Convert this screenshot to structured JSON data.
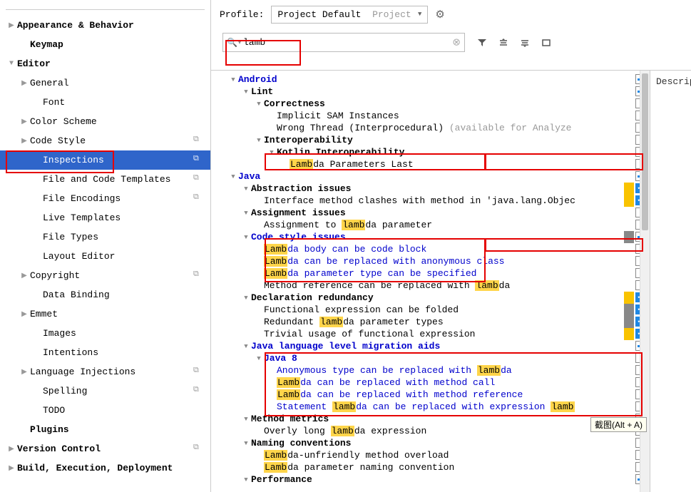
{
  "sidebar": {
    "items": [
      {
        "label": "Appearance & Behavior",
        "arrow": "right",
        "bold": true,
        "ind": 0
      },
      {
        "label": "Keymap",
        "arrow": "",
        "bold": true,
        "ind": 1
      },
      {
        "label": "Editor",
        "arrow": "down",
        "bold": true,
        "ind": 0
      },
      {
        "label": "General",
        "arrow": "right",
        "bold": false,
        "ind": 1
      },
      {
        "label": "Font",
        "arrow": "",
        "bold": false,
        "ind": 2
      },
      {
        "label": "Color Scheme",
        "arrow": "right",
        "bold": false,
        "ind": 1
      },
      {
        "label": "Code Style",
        "arrow": "right",
        "bold": false,
        "ind": 1,
        "copy": true
      },
      {
        "label": "Inspections",
        "arrow": "",
        "bold": false,
        "ind": 2,
        "copy": true,
        "selected": true
      },
      {
        "label": "File and Code Templates",
        "arrow": "",
        "bold": false,
        "ind": 2,
        "copy": true
      },
      {
        "label": "File Encodings",
        "arrow": "",
        "bold": false,
        "ind": 2,
        "copy": true
      },
      {
        "label": "Live Templates",
        "arrow": "",
        "bold": false,
        "ind": 2
      },
      {
        "label": "File Types",
        "arrow": "",
        "bold": false,
        "ind": 2
      },
      {
        "label": "Layout Editor",
        "arrow": "",
        "bold": false,
        "ind": 2
      },
      {
        "label": "Copyright",
        "arrow": "right",
        "bold": false,
        "ind": 1,
        "copy": true
      },
      {
        "label": "Data Binding",
        "arrow": "",
        "bold": false,
        "ind": 2
      },
      {
        "label": "Emmet",
        "arrow": "right",
        "bold": false,
        "ind": 1
      },
      {
        "label": "Images",
        "arrow": "",
        "bold": false,
        "ind": 2
      },
      {
        "label": "Intentions",
        "arrow": "",
        "bold": false,
        "ind": 2
      },
      {
        "label": "Language Injections",
        "arrow": "right",
        "bold": false,
        "ind": 1,
        "copy": true
      },
      {
        "label": "Spelling",
        "arrow": "",
        "bold": false,
        "ind": 2,
        "copy": true
      },
      {
        "label": "TODO",
        "arrow": "",
        "bold": false,
        "ind": 2
      },
      {
        "label": "Plugins",
        "arrow": "",
        "bold": true,
        "ind": 1
      },
      {
        "label": "Version Control",
        "arrow": "right",
        "bold": true,
        "ind": 0,
        "copy": true
      },
      {
        "label": "Build, Execution, Deployment",
        "arrow": "right",
        "bold": true,
        "ind": 0
      }
    ]
  },
  "profile": {
    "label": "Profile:",
    "name": "Project Default",
    "scope": "Project"
  },
  "search": {
    "value": "lamb",
    "placeholder": ""
  },
  "right_panel": {
    "label": "Descripti"
  },
  "tooltip": "截图(Alt + A)",
  "tree": [
    {
      "ind": 0,
      "arrow": "down",
      "parts": [
        {
          "t": "Android",
          "cls": "blue-link bold"
        }
      ],
      "chk": "mixed"
    },
    {
      "ind": 1,
      "arrow": "down",
      "parts": [
        {
          "t": "Lint",
          "cls": "bold"
        }
      ],
      "chk": "mixed"
    },
    {
      "ind": 2,
      "arrow": "down",
      "parts": [
        {
          "t": "Correctness",
          "cls": "bold"
        }
      ],
      "chk": ""
    },
    {
      "ind": 3,
      "arrow": "",
      "parts": [
        {
          "t": "Implicit SAM Instances"
        }
      ],
      "chk": ""
    },
    {
      "ind": 3,
      "arrow": "",
      "parts": [
        {
          "t": "Wrong Thread (Interprocedural) "
        },
        {
          "t": "(available for Analyze",
          "cls": "gray-txt"
        }
      ],
      "chk": ""
    },
    {
      "ind": 2,
      "arrow": "down",
      "parts": [
        {
          "t": "Interoperability",
          "cls": "bold"
        }
      ],
      "chk": ""
    },
    {
      "ind": 3,
      "arrow": "down",
      "parts": [
        {
          "t": "Kotlin Interoperability",
          "cls": "bold"
        }
      ],
      "chk": ""
    },
    {
      "ind": 4,
      "arrow": "",
      "parts": [
        {
          "t": "Lamb",
          "cls": "hl"
        },
        {
          "t": "da Parameters Last"
        }
      ],
      "chk": ""
    },
    {
      "ind": 0,
      "arrow": "down",
      "parts": [
        {
          "t": "Java",
          "cls": "blue-link bold"
        }
      ],
      "chk": "mixed"
    },
    {
      "ind": 1,
      "arrow": "down",
      "parts": [
        {
          "t": "Abstraction issues",
          "cls": "bold"
        }
      ],
      "sev": "yellow",
      "chk": "checked"
    },
    {
      "ind": 2,
      "arrow": "",
      "parts": [
        {
          "t": "Interface method clashes with method in 'java.lang.Objec"
        }
      ],
      "sev": "yellow",
      "chk": "checked"
    },
    {
      "ind": 1,
      "arrow": "down",
      "parts": [
        {
          "t": "Assignment issues",
          "cls": "bold"
        }
      ],
      "chk": ""
    },
    {
      "ind": 2,
      "arrow": "",
      "parts": [
        {
          "t": "Assignment to "
        },
        {
          "t": "lamb",
          "cls": "hl"
        },
        {
          "t": "da parameter"
        }
      ],
      "chk": ""
    },
    {
      "ind": 1,
      "arrow": "down",
      "parts": [
        {
          "t": "Code style issues",
          "cls": "blue-link bold"
        }
      ],
      "sev": "gray",
      "chk": "mixed"
    },
    {
      "ind": 2,
      "arrow": "",
      "parts": [
        {
          "t": "Lamb",
          "cls": "hl"
        },
        {
          "t": "da body can be code block",
          "cls": "blue-link"
        }
      ],
      "chk": ""
    },
    {
      "ind": 2,
      "arrow": "",
      "parts": [
        {
          "t": "Lamb",
          "cls": "hl"
        },
        {
          "t": "da can be replaced with anonymous class",
          "cls": "blue-link"
        }
      ],
      "chk": ""
    },
    {
      "ind": 2,
      "arrow": "",
      "parts": [
        {
          "t": "Lamb",
          "cls": "hl"
        },
        {
          "t": "da parameter type can be specified",
          "cls": "blue-link"
        }
      ],
      "chk": ""
    },
    {
      "ind": 2,
      "arrow": "",
      "parts": [
        {
          "t": "Method reference can be replaced with "
        },
        {
          "t": "lamb",
          "cls": "hl"
        },
        {
          "t": "da"
        }
      ],
      "chk": ""
    },
    {
      "ind": 1,
      "arrow": "down",
      "parts": [
        {
          "t": "Declaration redundancy",
          "cls": "bold"
        }
      ],
      "sev": "yellow",
      "chk": "checked"
    },
    {
      "ind": 2,
      "arrow": "",
      "parts": [
        {
          "t": "Functional expression can be folded"
        }
      ],
      "sev": "gray",
      "chk": "checked"
    },
    {
      "ind": 2,
      "arrow": "",
      "parts": [
        {
          "t": "Redundant "
        },
        {
          "t": "lamb",
          "cls": "hl"
        },
        {
          "t": "da parameter types"
        }
      ],
      "sev": "gray",
      "chk": "checked"
    },
    {
      "ind": 2,
      "arrow": "",
      "parts": [
        {
          "t": "Trivial usage of functional expression"
        }
      ],
      "sev": "yellow",
      "chk": "checked"
    },
    {
      "ind": 1,
      "arrow": "down",
      "parts": [
        {
          "t": "Java language level migration aids",
          "cls": "blue-link bold"
        }
      ],
      "chk": "mixed"
    },
    {
      "ind": 2,
      "arrow": "down",
      "parts": [
        {
          "t": "Java 8",
          "cls": "blue-link bold"
        }
      ],
      "chk": ""
    },
    {
      "ind": 3,
      "arrow": "",
      "parts": [
        {
          "t": "Anonymous type can be replaced with ",
          "cls": "blue-link"
        },
        {
          "t": "lamb",
          "cls": "hl"
        },
        {
          "t": "da",
          "cls": "blue-link"
        }
      ],
      "chk": ""
    },
    {
      "ind": 3,
      "arrow": "",
      "parts": [
        {
          "t": "Lamb",
          "cls": "hl"
        },
        {
          "t": "da can be replaced with method call",
          "cls": "blue-link"
        }
      ],
      "chk": ""
    },
    {
      "ind": 3,
      "arrow": "",
      "parts": [
        {
          "t": "Lamb",
          "cls": "hl"
        },
        {
          "t": "da can be replaced with method reference",
          "cls": "blue-link"
        }
      ],
      "chk": ""
    },
    {
      "ind": 3,
      "arrow": "",
      "parts": [
        {
          "t": "Statement ",
          "cls": "blue-link"
        },
        {
          "t": "lamb",
          "cls": "hl"
        },
        {
          "t": "da can be replaced with expression ",
          "cls": "blue-link"
        },
        {
          "t": "lamb",
          "cls": "hl"
        }
      ],
      "chk": ""
    },
    {
      "ind": 1,
      "arrow": "down",
      "parts": [
        {
          "t": "Method metrics",
          "cls": "bold"
        }
      ],
      "chk": ""
    },
    {
      "ind": 2,
      "arrow": "",
      "parts": [
        {
          "t": "Overly long "
        },
        {
          "t": "lamb",
          "cls": "hl"
        },
        {
          "t": "da expression"
        }
      ],
      "chk": ""
    },
    {
      "ind": 1,
      "arrow": "down",
      "parts": [
        {
          "t": "Naming conventions",
          "cls": "bold"
        }
      ],
      "chk": ""
    },
    {
      "ind": 2,
      "arrow": "",
      "parts": [
        {
          "t": "Lamb",
          "cls": "hl"
        },
        {
          "t": "da-unfriendly method overload"
        }
      ],
      "chk": ""
    },
    {
      "ind": 2,
      "arrow": "",
      "parts": [
        {
          "t": "Lamb",
          "cls": "hl"
        },
        {
          "t": "da parameter naming convention"
        }
      ],
      "chk": ""
    },
    {
      "ind": 1,
      "arrow": "down",
      "parts": [
        {
          "t": "Performance",
          "cls": "bold"
        }
      ],
      "chk": "mixed"
    }
  ]
}
